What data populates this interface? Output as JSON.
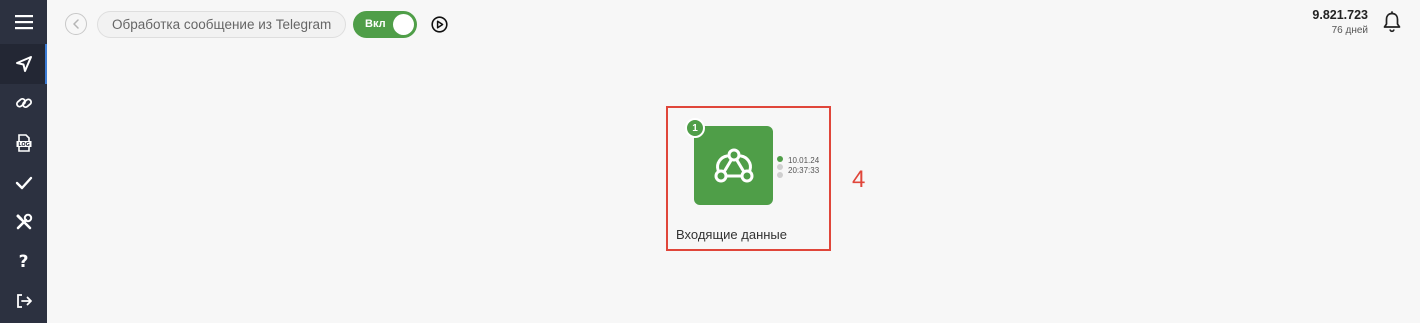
{
  "sidebar": {
    "items": [
      {
        "name": "menu-icon"
      },
      {
        "name": "send-icon",
        "active": true
      },
      {
        "name": "link-icon"
      },
      {
        "name": "log-icon",
        "label": "LOG"
      },
      {
        "name": "check-icon"
      },
      {
        "name": "tools-icon"
      },
      {
        "name": "help-icon",
        "label": "?"
      },
      {
        "name": "logout-icon"
      }
    ]
  },
  "header": {
    "title": "Обработка сообщение из Telegram",
    "toggle_label": "Вкл",
    "toggle_on": true,
    "balance": "9.821.723",
    "days": "76 дней"
  },
  "canvas": {
    "node": {
      "badge": "1",
      "date": "10.01.24",
      "time": "20:37:33",
      "title": "Входящие данные",
      "icon": "webhook-icon"
    },
    "annotation": "4"
  },
  "colors": {
    "sidebar_bg": "#2c3140",
    "accent_green": "#4f9e48",
    "highlight_red": "#e0463a",
    "active_blue": "#3a7bd5"
  }
}
